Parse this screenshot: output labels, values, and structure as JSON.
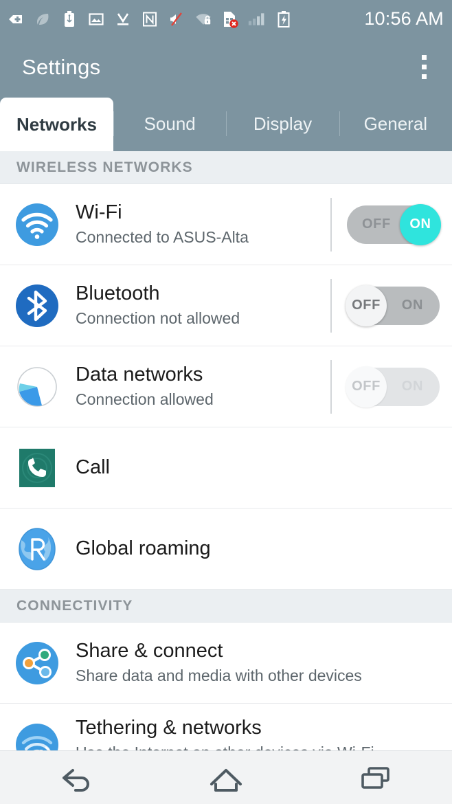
{
  "status_bar": {
    "time": "10:56 AM",
    "icons": [
      "usb-debugging-icon",
      "leaf-power-save-icon",
      "usb-connected-icon",
      "screenshot-image-icon",
      "download-complete-icon",
      "nfc-icon",
      "mute-silent-icon",
      "wifi-secured-icon",
      "sim-card-error-icon",
      "cellular-signal-icon",
      "battery-charging-icon"
    ]
  },
  "header": {
    "title": "Settings",
    "overflow_label": "More options"
  },
  "tabs": {
    "active_index": 0,
    "items": [
      {
        "label": "Networks"
      },
      {
        "label": "Sound"
      },
      {
        "label": "Display"
      },
      {
        "label": "General"
      }
    ]
  },
  "sections": [
    {
      "title": "WIRELESS NETWORKS",
      "rows": [
        {
          "title": "Wi-Fi",
          "subtitle": "Connected to ASUS-Alta",
          "icon": "wifi-icon",
          "toggle": {
            "state": "on",
            "off_label": "OFF",
            "on_label": "ON"
          }
        },
        {
          "title": "Bluetooth",
          "subtitle": "Connection not allowed",
          "icon": "bluetooth-icon",
          "toggle": {
            "state": "off",
            "off_label": "OFF",
            "on_label": "ON"
          }
        },
        {
          "title": "Data networks",
          "subtitle": "Connection allowed",
          "icon": "data-networks-icon",
          "toggle": {
            "state": "disabled",
            "off_label": "OFF",
            "on_label": "ON"
          }
        },
        {
          "title": "Call",
          "subtitle": "",
          "icon": "call-icon",
          "toggle": null
        },
        {
          "title": "Global roaming",
          "subtitle": "",
          "icon": "global-roaming-icon",
          "toggle": null
        }
      ]
    },
    {
      "title": "CONNECTIVITY",
      "rows": [
        {
          "title": "Share & connect",
          "subtitle": "Share data and media with other devices",
          "icon": "share-connect-icon",
          "toggle": null
        },
        {
          "title": "Tethering & networks",
          "subtitle": "Use the Internet on other devices via Wi-Fi",
          "icon": "tethering-icon",
          "toggle": null
        }
      ]
    }
  ],
  "nav_bar": {
    "back_label": "Back",
    "home_label": "Home",
    "recents_label": "Recent apps"
  },
  "colors": {
    "chrome": "#7d94a0",
    "section_bg": "#ebeff2",
    "toggle_on": "#2fe4dd",
    "wifi_blue": "#3e9be0",
    "bluetooth_blue": "#1f6bc0",
    "call_teal": "#1f7a6a"
  }
}
